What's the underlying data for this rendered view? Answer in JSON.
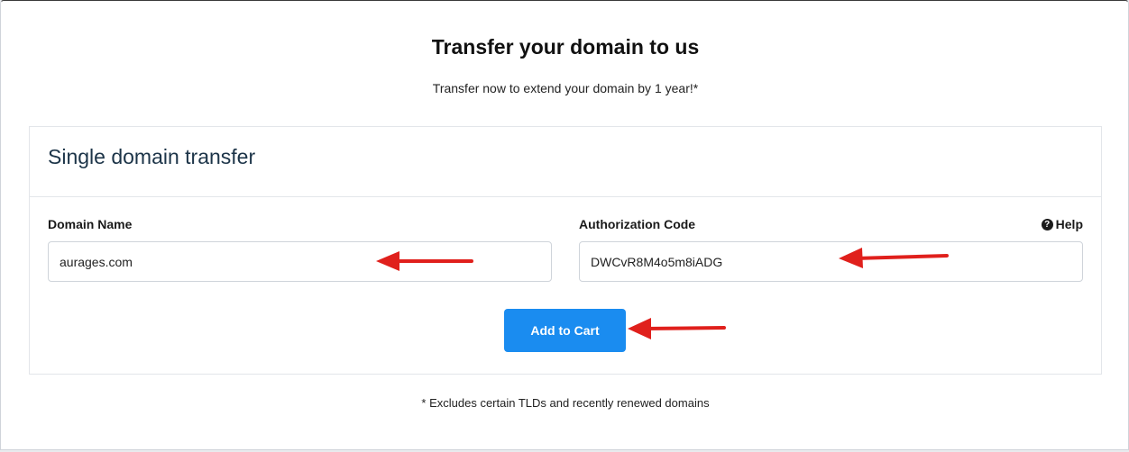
{
  "page": {
    "title": "Transfer your domain to us",
    "subtitle": "Transfer now to extend your domain by 1 year!*",
    "footnote": "* Excludes certain TLDs and recently renewed domains"
  },
  "panel": {
    "title": "Single domain transfer",
    "domain_field": {
      "label": "Domain Name",
      "value": "aurages.com"
    },
    "auth_field": {
      "label": "Authorization Code",
      "value": "DWCvR8M4o5m8iADG"
    },
    "help": {
      "icon": "question-circle-icon",
      "label": "Help"
    },
    "add_button_label": "Add to Cart"
  },
  "colors": {
    "accent": "#1a8cf0",
    "annotation_arrow": "#e0201c"
  }
}
